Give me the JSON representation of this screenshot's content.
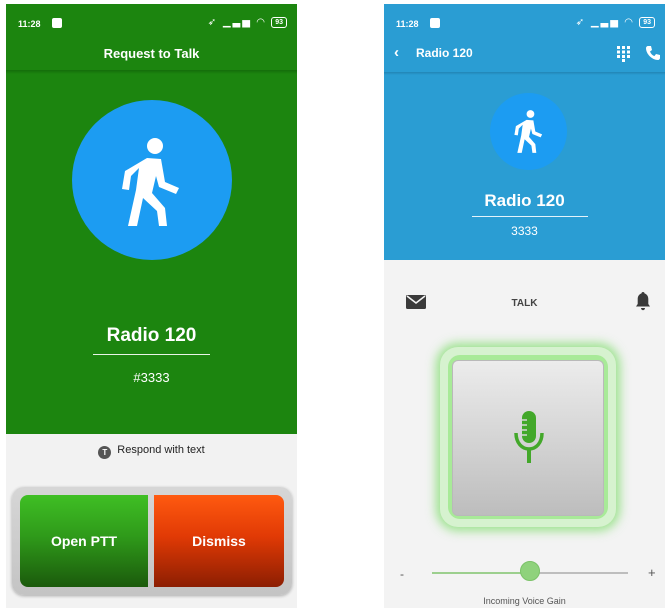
{
  "colors": {
    "left_bg": "#1c850f",
    "right_bg": "#2a9dd3",
    "avatar": "#1c9cf2",
    "open_ptt": "#2f9a1a",
    "dismiss": "#e13a05",
    "mic": "#43a82a",
    "glow": "#8fe27a"
  },
  "left": {
    "status": {
      "time": "11:28",
      "battery": "93"
    },
    "title": "Request to Talk",
    "avatar_icon": "walking-person-icon",
    "contact_name": "Radio 120",
    "contact_number": "#3333",
    "respond_icon": "T",
    "respond_label": "Respond with text",
    "buttons": {
      "open": "Open PTT",
      "dismiss": "Dismiss"
    }
  },
  "right": {
    "status": {
      "time": "11:28",
      "battery": "93"
    },
    "header_title": "Radio 120",
    "avatar_icon": "walking-person-icon",
    "contact_name": "Radio 120",
    "contact_number": "3333",
    "talk_label": "TALK",
    "talk_icon": "microphone-icon",
    "slider": {
      "minus": "-",
      "plus": "+",
      "label": "Incoming Voice Gain",
      "value_fraction": 0.47
    }
  }
}
